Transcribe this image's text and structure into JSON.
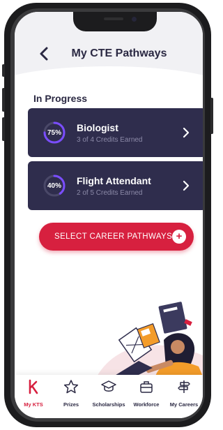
{
  "header": {
    "title": "My CTE Pathways",
    "back_icon": "chevron-left-icon"
  },
  "section": {
    "title": "In Progress"
  },
  "pathways": [
    {
      "percent_label": "75%",
      "progress": 0.75,
      "name": "Biologist",
      "credits": "3 of 4 Credits Earned"
    },
    {
      "percent_label": "40%",
      "progress": 0.4,
      "name": "Flight Attendant",
      "credits": "2 of 5 Credits Earned"
    }
  ],
  "cta": {
    "label": "SELECT CAREER PATHWAYS",
    "icon": "plus-icon"
  },
  "tabs": [
    {
      "label": "My KTS",
      "icon": "kts-logo-icon",
      "active": true
    },
    {
      "label": "Prizes",
      "icon": "star-icon",
      "active": false
    },
    {
      "label": "Scholarships",
      "icon": "graduation-cap-icon",
      "active": false
    },
    {
      "label": "Workforce",
      "icon": "briefcase-icon",
      "active": false
    },
    {
      "label": "My Careers",
      "icon": "signpost-icon",
      "active": false
    }
  ],
  "colors": {
    "accent": "#d7203f",
    "card_bg": "#2f2d4d",
    "progress_ring": "#7a4dff",
    "text_dark": "#2a2842"
  }
}
